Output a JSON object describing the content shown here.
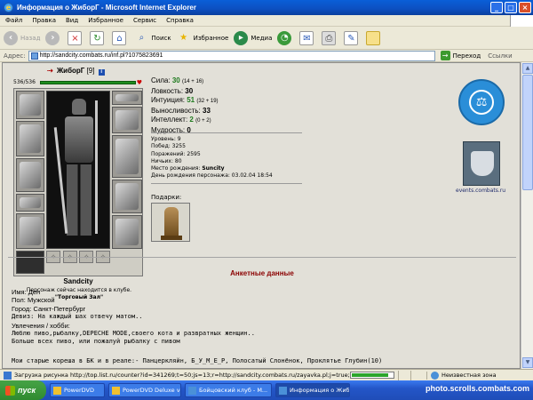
{
  "window": {
    "title": "Информация о ЖиборГ - Microsoft Internet Explorer"
  },
  "menu": [
    "Файл",
    "Правка",
    "Вид",
    "Избранное",
    "Сервис",
    "Справка"
  ],
  "toolbar": {
    "back": "Назад",
    "search": "Поиск",
    "favorites": "Избранное",
    "media": "Медиа"
  },
  "address": {
    "label": "Адрес:",
    "url": "http://sandcity.combats.ru/inf.pl?1075823691",
    "go": "Переход",
    "links": "Ссылки"
  },
  "character": {
    "name": "ЖиборГ",
    "level": "[9]",
    "hp": "536/536",
    "city": "Sandcity",
    "location_text": "Персонаж сейчас находится в клубе.",
    "location_room": "\"Торговый Зал\""
  },
  "stats": [
    {
      "label": "Сила:",
      "value": "30",
      "extra": "(14 + 16)",
      "green": true
    },
    {
      "label": "Ловкость:",
      "value": "30",
      "extra": "",
      "green": false
    },
    {
      "label": "Интуиция:",
      "value": "51",
      "extra": "(32 + 19)",
      "green": true
    },
    {
      "label": "Выносливость:",
      "value": "33",
      "extra": "",
      "green": false
    },
    {
      "label": "Интеллект:",
      "value": "2",
      "extra": "(0 + 2)",
      "green": true
    },
    {
      "label": "Мудрость:",
      "value": "0",
      "extra": "",
      "green": false
    }
  ],
  "info": {
    "level": "Уровень: 9",
    "wins": "Побед: 3255",
    "losses": "Поражений: 2595",
    "draws": "Ничьих: 80",
    "birthplace_label": "Место рождения: ",
    "birthplace": "Suncity",
    "birthday": "День рождения персонажа: 03.02.04 18:54"
  },
  "gifts_label": "Подарки:",
  "events_link": "events.combats.ru",
  "profile": {
    "title": "Анкетные данные",
    "name": "Имя: Ден",
    "sex": "Пол: Мужской",
    "city": "Город: Санкт-Петербург",
    "motto": "Девиз: На каждый шах отвечу матом..",
    "hobby_label": "Увлечения / хобби:",
    "hobby1": "Люблю пиво,рыбалку,DEPECHE MODE,своего кота и развратных женщин..",
    "hobby2": "Больше всех пиво, или пожалуй рыбалку с пивом",
    "friends": "Мои старые кореша в БК и в реале:- Панцеркляйн, Б_У_М_Е_Р, Полосатый Слонёнок, Проклятье Глубин(10)"
  },
  "status": {
    "text": "Загрузка рисунка http://top.list.ru/counter?id=341269;t=50;js=13;r=http://sandcity.combats.ru/zayavka.pl;j=true;s=1024",
    "progress": 0.9,
    "zone": "Неизвестная зона"
  },
  "taskbar": {
    "start": "пуск",
    "tasks": [
      "PowerDVD",
      "PowerDVD Deluxe ve...",
      "Бойцовский клуб - М...",
      "Информация о Жибо..."
    ],
    "watermark": "photo.scrolls.combats.com"
  }
}
